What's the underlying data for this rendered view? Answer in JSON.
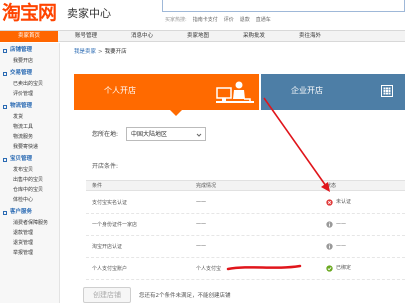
{
  "header": {
    "logo_main": "淘宝网",
    "logo_sub": "卖家中心",
    "hot_label": "买家热搜:",
    "hot_links": [
      "指南卡支付",
      "评价",
      "退款",
      "直通车"
    ]
  },
  "nav": {
    "tabs": [
      {
        "label": "卖家首页",
        "active": true
      },
      {
        "label": "账号管理",
        "active": false
      },
      {
        "label": "消息中心",
        "active": false
      },
      {
        "label": "卖家地图",
        "active": false
      },
      {
        "label": "采购批发",
        "active": false
      },
      {
        "label": "卖往海外",
        "active": false
      }
    ]
  },
  "sidebar": {
    "groups": [
      {
        "title": "店铺管理",
        "items": [
          "我要开店"
        ]
      },
      {
        "title": "交易管理",
        "items": [
          "已卖出的宝贝",
          "评价管理"
        ]
      },
      {
        "title": "物流管理",
        "items": [
          "发货",
          "物流工具",
          "物流服务",
          "我要寄快递"
        ]
      },
      {
        "title": "宝贝管理",
        "items": [
          "发布宝贝",
          "出售中的宝贝",
          "仓库中的宝贝",
          "体检中心"
        ]
      },
      {
        "title": "客户服务",
        "items": [
          "消费者保障服务",
          "退款管理",
          "退货管理",
          "举报管理"
        ]
      }
    ]
  },
  "breadcrumb": {
    "home": "我是卖家",
    "separator": ">",
    "current": "我要开店"
  },
  "open_options": {
    "personal": "个人开店",
    "enterprise": "企业开店"
  },
  "location": {
    "label": "您所在地:",
    "value": "中国大陆地区"
  },
  "conditions": {
    "label": "开店条件:",
    "headers": {
      "condition": "条件",
      "status": "完成情况",
      "state": "状态"
    },
    "rows": [
      {
        "name": "支付宝实名认证",
        "detail": "一一",
        "status": "未认证",
        "state": "fail"
      },
      {
        "name": "一个身份证件一家店",
        "detail": "一一",
        "status": "——",
        "state": "info"
      },
      {
        "name": "淘宝开店认证",
        "detail": "一一",
        "status": "——",
        "state": "info"
      },
      {
        "name": "个人支付宝账户",
        "detail": "个人支付宝",
        "status": "已绑定",
        "state": "ok"
      }
    ]
  },
  "actions": {
    "create_label": "创建店铺",
    "create_note": "您还有2个条件未满足，不能创建店铺"
  },
  "colors": {
    "accent": "#ff6600",
    "brand": "#ff4400",
    "enterprise": "#4d7ea6",
    "link": "#2a6ab3",
    "fail": "#e03c3c",
    "ok": "#6aa820",
    "annotation": "#e0151b"
  },
  "icons": {
    "personal": "person-at-computer-icon",
    "enterprise": "building-grid-icon",
    "fail": "x-circle-icon",
    "info": "info-circle-icon",
    "ok": "check-circle-icon"
  }
}
